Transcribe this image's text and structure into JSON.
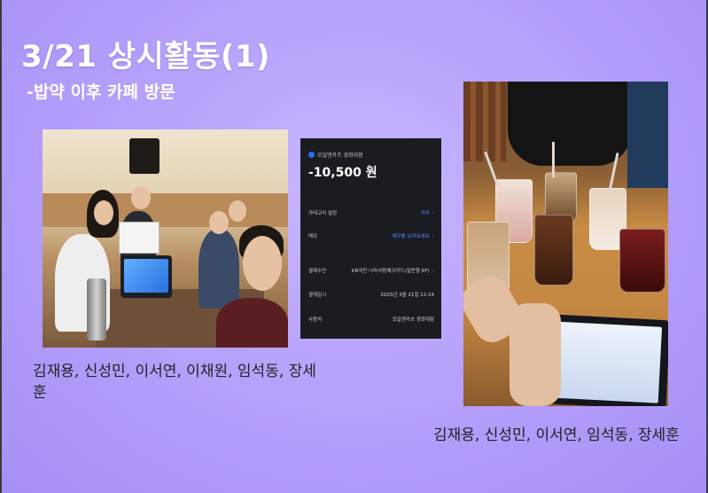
{
  "slide": {
    "title": "3/21 상시활동(1)",
    "subtitle": "-밥약 이후 카페 방문",
    "accent_color": "#b7a2fb",
    "title_color": "#ffffff"
  },
  "photo_left": {
    "caption": "김재용, 신성민, 이서연, 이채원, 임석동, 장세훈"
  },
  "payment_screen": {
    "merchant": "모일앤카츠 경희대점",
    "amount": "-10,500 원",
    "rows": [
      {
        "label": "카테고리 설정",
        "value": "식비"
      },
      {
        "label": "메모",
        "value": "메모를 남겨보세요"
      },
      {
        "label": "결제수단",
        "value": "KB국민 나라사랑체크카드(일반형 RF)"
      },
      {
        "label": "결제일시",
        "value": "2025년 3월 21일 12:24"
      },
      {
        "label": "사용처",
        "value": "모일앤카츠 경희대점"
      }
    ]
  },
  "photo_right": {
    "caption": "김재용, 신성민, 이서연, 임석동, 장세훈"
  }
}
